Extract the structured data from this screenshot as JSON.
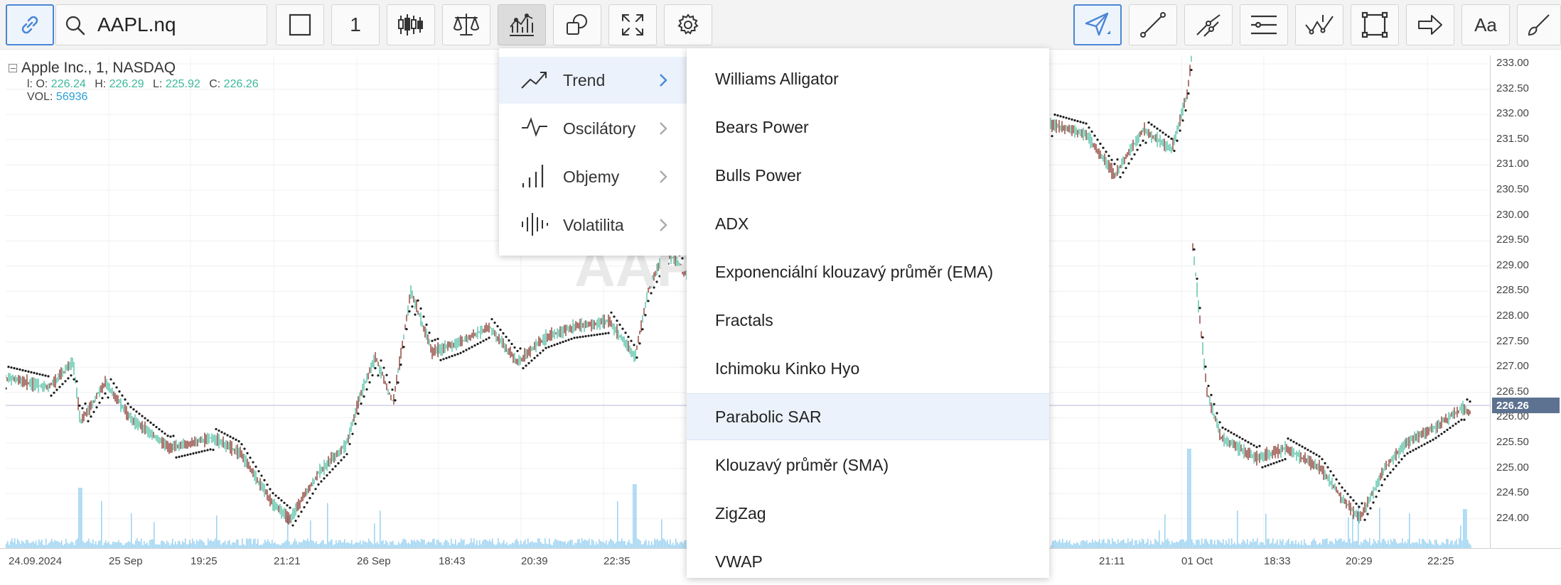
{
  "toolbar": {
    "symbol_value": "AAPL.nq",
    "interval_label": "1",
    "buttons": [
      "link",
      "search",
      "chart-style",
      "interval",
      "candles",
      "compare",
      "indicators",
      "shapes",
      "fullscreen",
      "settings",
      "cursor",
      "line",
      "segments",
      "horizontal-lines",
      "measure",
      "rectangle",
      "arrow",
      "text",
      "brush"
    ],
    "text_tool_label": "Aa"
  },
  "legend": {
    "title": "Apple Inc.,  1,  NASDAQ",
    "ohlc": [
      {
        "key": "l: O:",
        "value": "226.24"
      },
      {
        "key": "H:",
        "value": "226.29"
      },
      {
        "key": "L:",
        "value": "225.92"
      },
      {
        "key": "C:",
        "value": "226.26"
      }
    ],
    "vol_key": "VOL:",
    "vol_value": "56936"
  },
  "price_axis": {
    "labels": [
      "233.00",
      "232.50",
      "232.00",
      "231.50",
      "231.00",
      "230.50",
      "230.00",
      "229.50",
      "229.00",
      "228.50",
      "228.00",
      "227.50",
      "227.00",
      "226.50",
      "226.00",
      "225.50",
      "225.00",
      "224.50",
      "224.00"
    ],
    "current": "226.26"
  },
  "time_axis": {
    "labels": [
      "24.09.2024",
      "25 Sep",
      "19:25",
      "21:21",
      "26 Sep",
      "18:43",
      "20:39",
      "22:35",
      "21:11",
      "01 Oct",
      "18:33",
      "20:29",
      "22:25"
    ]
  },
  "category_menu": {
    "items": [
      {
        "label": "Trend",
        "icon": "trend-icon",
        "active": true
      },
      {
        "label": "Oscilátory",
        "icon": "oscillator-icon",
        "active": false
      },
      {
        "label": "Objemy",
        "icon": "volume-icon",
        "active": false
      },
      {
        "label": "Volatilita",
        "icon": "volatility-icon",
        "active": false
      }
    ]
  },
  "indicator_menu": {
    "items": [
      "Williams Alligator",
      "Bears Power",
      "Bulls Power",
      "ADX",
      "Exponenciální klouzavý průměr (EMA)",
      "Fractals",
      "Ichimoku Kinko Hyo",
      "Parabolic SAR",
      "Klouzavý průměr (SMA)",
      "ZigZag",
      "VWAP"
    ],
    "highlighted": "Parabolic SAR"
  },
  "colors": {
    "accent": "#4a86d6",
    "up": "#3cb89a",
    "down": "#7a1f14",
    "sar": "#1b1b1b",
    "volume": "#9fd4f2",
    "price_badge": "#5d7290"
  }
}
